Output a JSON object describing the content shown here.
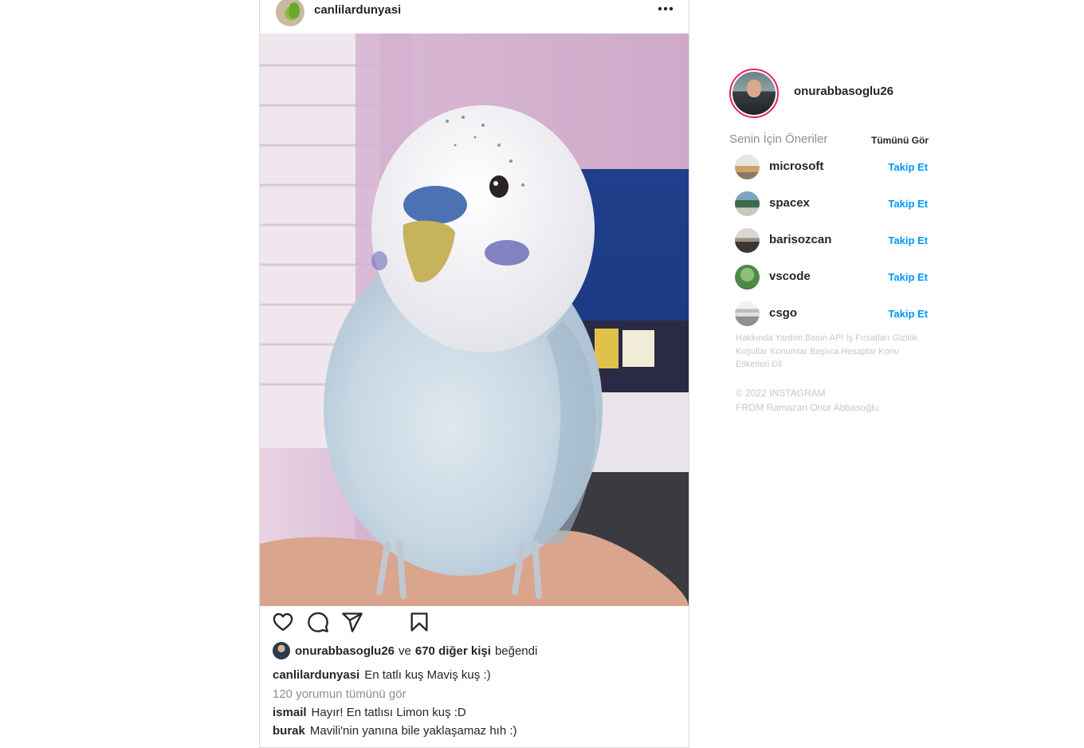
{
  "post": {
    "username": "canlilardunyasi",
    "likes": {
      "user": "onurabbasoglu26",
      "connector": "ve",
      "others": "670 diğer kişi",
      "suffix": "beğendi"
    },
    "caption": {
      "user": "canlilardunyasi",
      "text": "En tatlı kuş Maviş kuş :)"
    },
    "view_all_comments": "120 yorumun tümünü gör",
    "comments": [
      {
        "user": "ismail",
        "text": "Hayır! En tatlısı Limon kuş :D"
      },
      {
        "user": "burak",
        "text": "Mavili'nin yanına bile yaklaşamaz hıh :)"
      }
    ]
  },
  "sidebar": {
    "current_user": "onurabbasoglu26",
    "suggestions_title": "Senin İçin Öneriler",
    "see_all": "Tümünü Gör",
    "suggestions": [
      {
        "name": "microsoft",
        "action": "Takip Et"
      },
      {
        "name": "spacex",
        "action": "Takip Et"
      },
      {
        "name": "barisozcan",
        "action": "Takip Et"
      },
      {
        "name": "vscode",
        "action": "Takip Et"
      },
      {
        "name": "csgo",
        "action": "Takip Et"
      }
    ],
    "footer_links": [
      "Hakkında",
      "Yardım",
      "Basın",
      "API",
      "İş Fırsatları",
      "Gizlilik",
      "Koşullar",
      "Konumlar",
      "Başlıca Hesaplar",
      "Konu Etiketleri",
      "Dil"
    ],
    "copyright": "© 2022 INSTAGRAM",
    "credit": "FROM Ramazan Onur Abbasoğlu"
  },
  "colors": {
    "link_blue": "#0095f6",
    "story_ring": "#e2245a",
    "muted": "#8e8e8e",
    "border": "#dbdbdb"
  },
  "icons": [
    "more-icon",
    "heart-icon",
    "comment-icon",
    "share-icon",
    "bookmark-icon"
  ]
}
